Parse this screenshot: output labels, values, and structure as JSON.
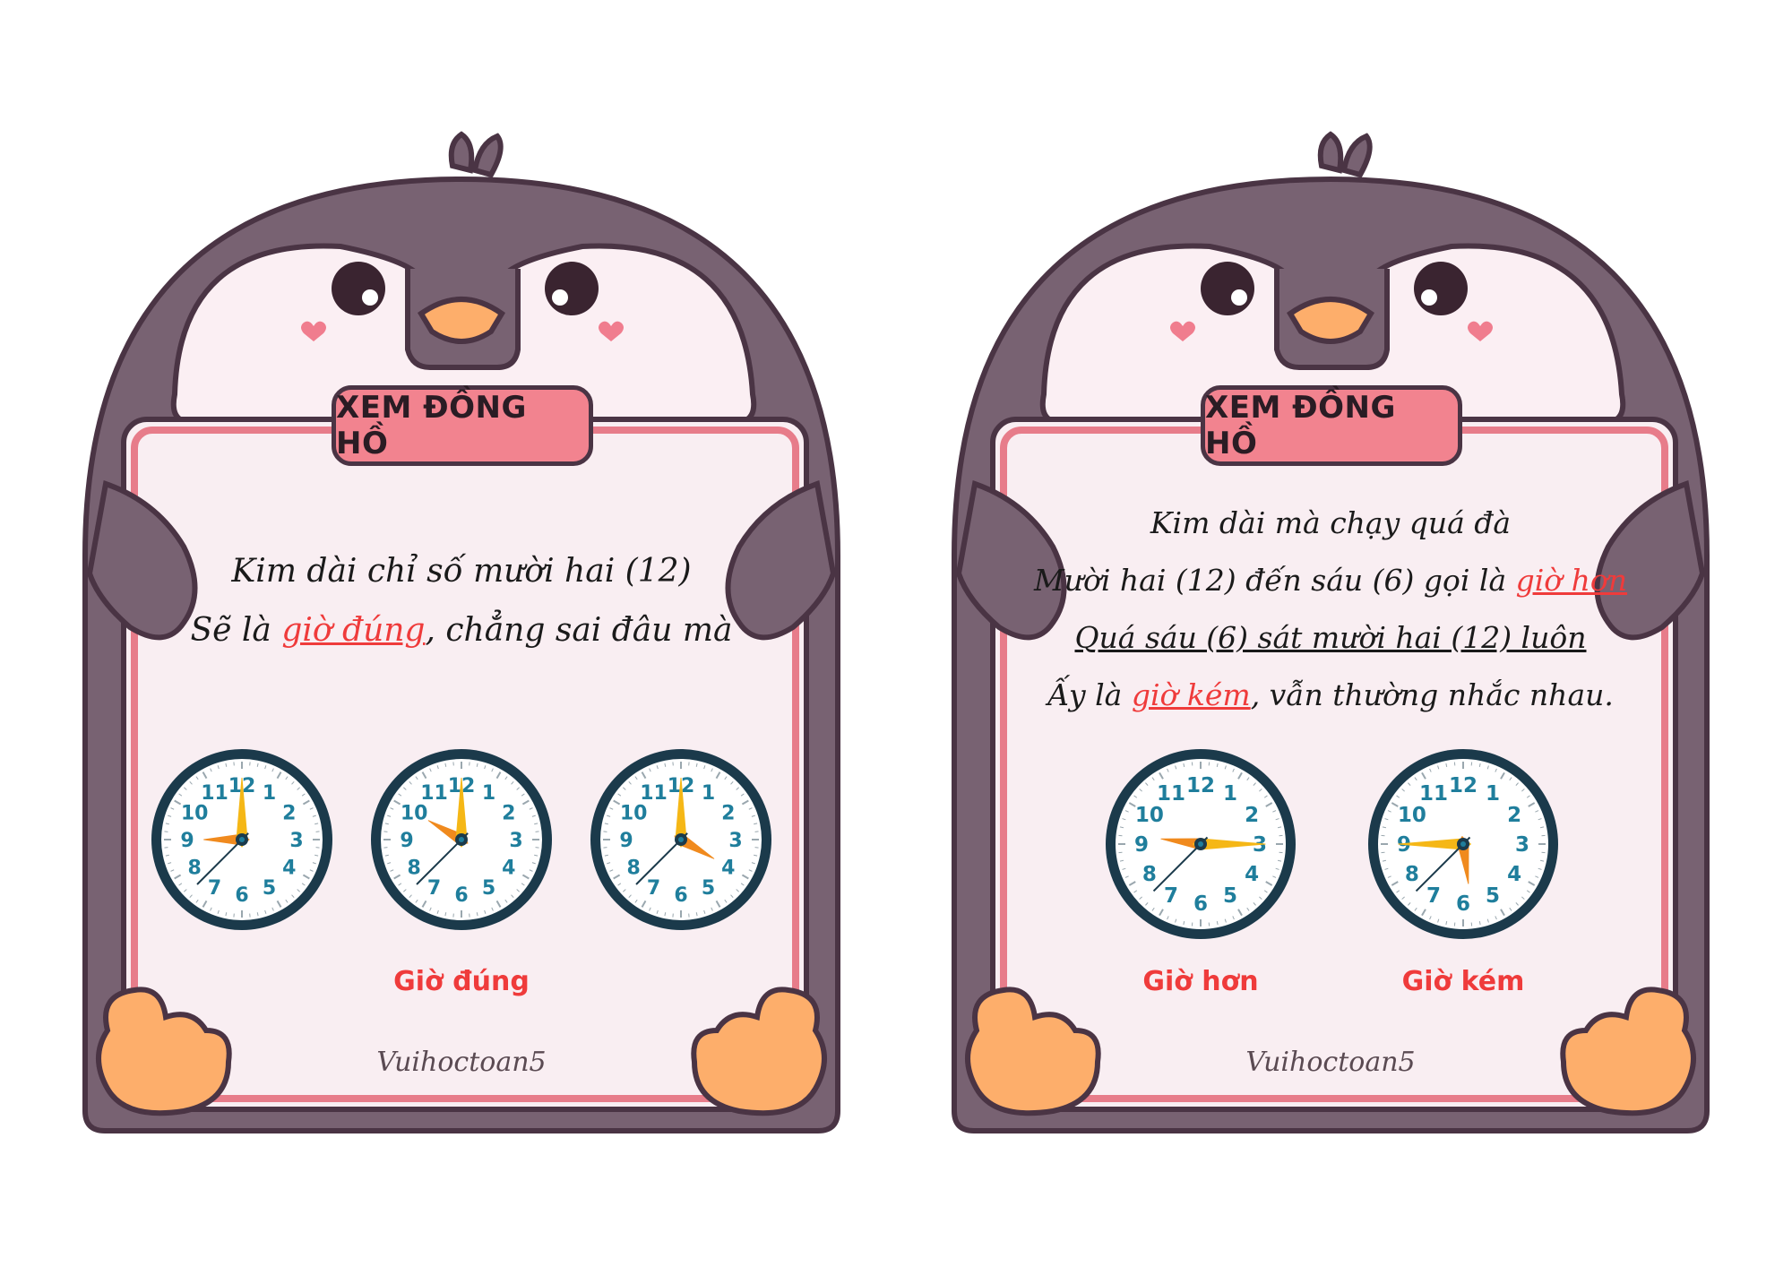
{
  "cards": [
    {
      "title": "XEM ĐỒNG HỒ",
      "poem_lines": [
        [
          {
            "t": "Kim dài chỉ số mười hai (12)"
          }
        ],
        [
          {
            "t": "Sẽ là "
          },
          {
            "t": "giờ đúng",
            "hl": true
          },
          {
            "t": ", chẳng sai đâu mà"
          }
        ]
      ],
      "clocks": [
        {
          "hour": 9,
          "minute": 0,
          "second": 7
        },
        {
          "hour": 10,
          "minute": 0,
          "second": 7
        },
        {
          "hour": 4,
          "minute": 0,
          "second": 7
        }
      ],
      "labels": [
        "Giờ đúng"
      ],
      "brand": "Vuihoctoan5"
    },
    {
      "title": "XEM ĐỒNG HỒ",
      "poem_lines": [
        [
          {
            "t": "Kim dài mà chạy quá đà"
          }
        ],
        [
          {
            "t": "Mười hai (12) đến sáu (6) gọi là "
          },
          {
            "t": "giờ hơn",
            "hl": true
          }
        ],
        [
          {
            "t": "Quá sáu (6) sát mười hai (12) luôn",
            "ul": true
          }
        ],
        [
          {
            "t": "Ấy là "
          },
          {
            "t": "giờ kém",
            "hl": true
          },
          {
            "t": ", vẫn thường nhắc nhau."
          }
        ]
      ],
      "clocks": [
        {
          "hour": 9,
          "minute": 15,
          "second": 7
        },
        {
          "hour": 5,
          "minute": 45,
          "second": 7
        }
      ],
      "labels": [
        "Giờ hơn",
        "Giờ kém"
      ],
      "brand": "Vuihoctoan5"
    }
  ],
  "colors": {
    "penguin_body": "#786272",
    "outline": "#4a3444",
    "face": "#fbeff3",
    "board": "#f9eef2",
    "border_pink": "#e77c8a",
    "beak": "#fdae6b",
    "badge": "#f2838f",
    "highlight": "#ef3b3b",
    "hour_hand": "#f08a1e",
    "minute_hand": "#f5b716",
    "clock_ring": "#1b3a4b",
    "clock_numbers": "#1f7e9c"
  }
}
